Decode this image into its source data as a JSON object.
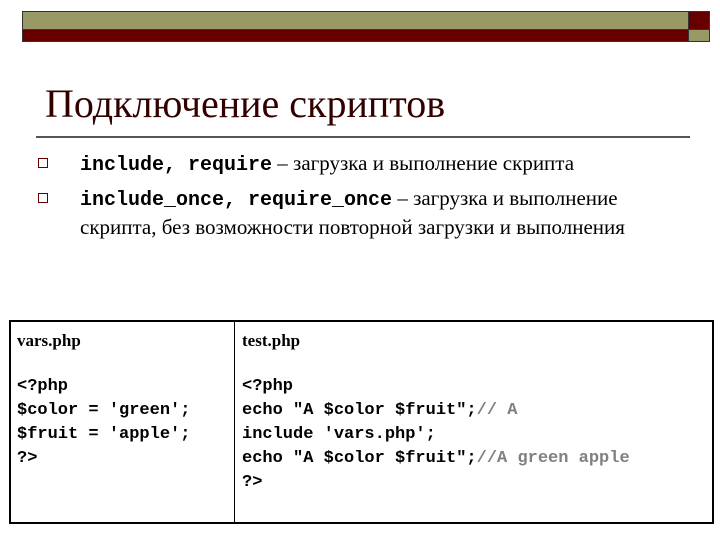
{
  "slide": {
    "title": "Подключение скриптов",
    "colors": {
      "olive": "#999966",
      "maroon": "#660000",
      "title": "#330000",
      "comment": "#808080"
    }
  },
  "bullets": [
    {
      "code": "include, require",
      "text": " – загрузка и выполнение скрипта"
    },
    {
      "code": "include_once, require_once",
      "text": " – загрузка и выполнение скрипта, без возможности повторной загрузки и выполнения"
    }
  ],
  "table": {
    "left": {
      "filename": "vars.php",
      "lines": [
        "<?php",
        "$color = 'green';",
        "$fruit = 'apple';",
        "?>"
      ]
    },
    "right": {
      "filename": "test.php",
      "lines": [
        {
          "code": "<?php",
          "comment": ""
        },
        {
          "code": "echo \"A $color $fruit\";",
          "comment": "// A"
        },
        {
          "code": "include 'vars.php';",
          "comment": ""
        },
        {
          "code": "echo \"A $color $fruit\";",
          "comment": "//A green apple"
        },
        {
          "code": "?>",
          "comment": ""
        }
      ]
    }
  }
}
